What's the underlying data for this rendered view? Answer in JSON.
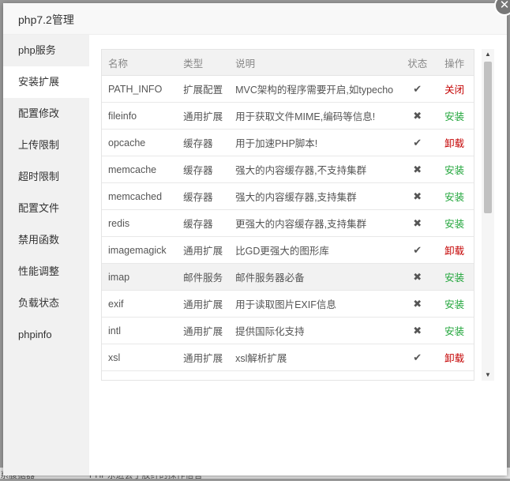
{
  "backdrop": {
    "left_text": "系腹据器",
    "mid_text": "PHP东进会于胶纤的探作信言"
  },
  "window": {
    "title": "php7.2管理",
    "close_glyph": "✕"
  },
  "sidebar": {
    "items": [
      {
        "label": "php服务",
        "active": false
      },
      {
        "label": "安装扩展",
        "active": true
      },
      {
        "label": "配置修改",
        "active": false
      },
      {
        "label": "上传限制",
        "active": false
      },
      {
        "label": "超时限制",
        "active": false
      },
      {
        "label": "配置文件",
        "active": false
      },
      {
        "label": "禁用函数",
        "active": false
      },
      {
        "label": "性能调整",
        "active": false
      },
      {
        "label": "负载状态",
        "active": false
      },
      {
        "label": "phpinfo",
        "active": false
      }
    ]
  },
  "table": {
    "headers": {
      "name": "名称",
      "type": "类型",
      "desc": "说明",
      "status": "状态",
      "action": "操作"
    },
    "rows": [
      {
        "name": "PATH_INFO",
        "type": "扩展配置",
        "desc": "MVC架构的程序需要开启,如typecho",
        "status": "✔",
        "action": "关闭",
        "action_kind": "remove"
      },
      {
        "name": "fileinfo",
        "type": "通用扩展",
        "desc": "用于获取文件MIME,编码等信息!",
        "status": "✖",
        "action": "安装",
        "action_kind": "install"
      },
      {
        "name": "opcache",
        "type": "缓存器",
        "desc": "用于加速PHP脚本!",
        "status": "✔",
        "action": "卸载",
        "action_kind": "remove"
      },
      {
        "name": "memcache",
        "type": "缓存器",
        "desc": "强大的内容缓存器,不支持集群",
        "status": "✖",
        "action": "安装",
        "action_kind": "install"
      },
      {
        "name": "memcached",
        "type": "缓存器",
        "desc": "强大的内容缓存器,支持集群",
        "status": "✖",
        "action": "安装",
        "action_kind": "install"
      },
      {
        "name": "redis",
        "type": "缓存器",
        "desc": "更强大的内容缓存器,支持集群",
        "status": "✖",
        "action": "安装",
        "action_kind": "install"
      },
      {
        "name": "imagemagick",
        "type": "通用扩展",
        "desc": "比GD更强大的图形库",
        "status": "✔",
        "action": "卸载",
        "action_kind": "remove"
      },
      {
        "name": "imap",
        "type": "邮件服务",
        "desc": "邮件服务器必备",
        "status": "✖",
        "action": "安装",
        "action_kind": "install",
        "highlight": true
      },
      {
        "name": "exif",
        "type": "通用扩展",
        "desc": "用于读取图片EXIF信息",
        "status": "✖",
        "action": "安装",
        "action_kind": "install"
      },
      {
        "name": "intl",
        "type": "通用扩展",
        "desc": "提供国际化支持",
        "status": "✖",
        "action": "安装",
        "action_kind": "install"
      },
      {
        "name": "xsl",
        "type": "通用扩展",
        "desc": "xsl解析扩展",
        "status": "✔",
        "action": "卸载",
        "action_kind": "remove"
      }
    ]
  },
  "scrollbar": {
    "up_glyph": "▲",
    "down_glyph": "▼"
  },
  "colors": {
    "install": "#20a53a",
    "remove": "#c40000"
  }
}
